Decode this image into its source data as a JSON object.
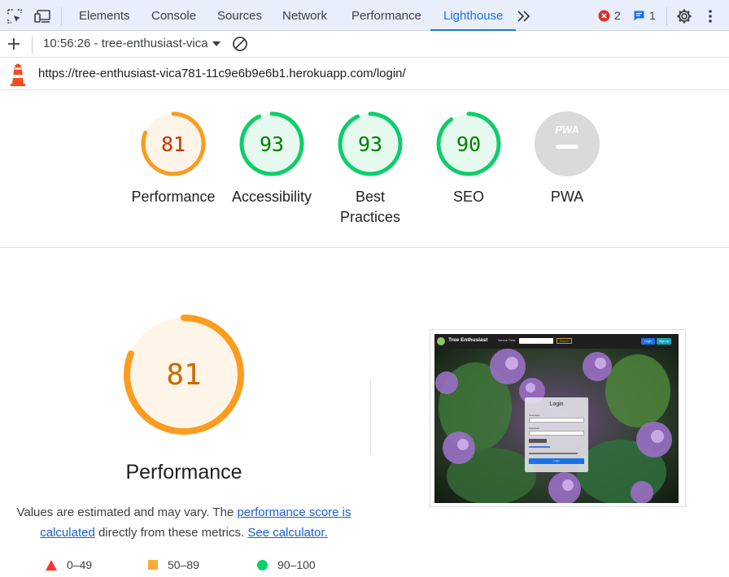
{
  "devtools": {
    "tabs": [
      "Elements",
      "Console",
      "Sources",
      "Network",
      "Performance",
      "Lighthouse"
    ],
    "active_tab": "Lighthouse",
    "errors_count": "2",
    "messages_count": "1"
  },
  "toolbar": {
    "report_selector": "10:56:26 - tree-enthusiast-vica"
  },
  "url": "https://tree-enthusiast-vica781-11c9e6b9e6b1.herokuapp.com/login/",
  "scores": [
    {
      "label": "Performance",
      "value": "81",
      "status": "average",
      "color": "#fa9c1e",
      "text_color": "#c33300",
      "fill": "#fff4e8"
    },
    {
      "label": "Accessibility",
      "value": "93",
      "status": "pass",
      "color": "#0cce6b",
      "text_color": "#008000",
      "fill": "#e6f9ee"
    },
    {
      "label": "Best Practices",
      "value": "93",
      "status": "pass",
      "color": "#0cce6b",
      "text_color": "#008000",
      "fill": "#e6f9ee"
    },
    {
      "label": "SEO",
      "value": "90",
      "status": "pass",
      "color": "#0cce6b",
      "text_color": "#008000",
      "fill": "#e6f9ee"
    },
    {
      "label": "PWA",
      "value": "PWA",
      "status": "na",
      "color": "#d9d9d9",
      "text_color": "#ffffff",
      "fill": "#dadada"
    }
  ],
  "performance": {
    "score": "81",
    "score_fraction": 0.81,
    "title": "Performance",
    "desc_part1": "Values are estimated and may vary. The ",
    "link_score": "performance score is calculated",
    "desc_part2": " directly from these metrics. ",
    "link_calc": "See calculator.",
    "legend": [
      {
        "label": "0–49",
        "shape": "triangle",
        "color": "#ff3333"
      },
      {
        "label": "50–89",
        "shape": "square",
        "color": "#ffaa33"
      },
      {
        "label": "90–100",
        "shape": "circle",
        "color": "#0cce6b"
      }
    ]
  },
  "screenshot": {
    "site_name": "Tree Enthusiast",
    "search_label": "Service Trees",
    "search_button": "Search",
    "login_button": "Login",
    "signup_button": "Sign Up",
    "card_title": "Login",
    "username_label": "Username",
    "password_label": "Password",
    "submit": "Login"
  }
}
